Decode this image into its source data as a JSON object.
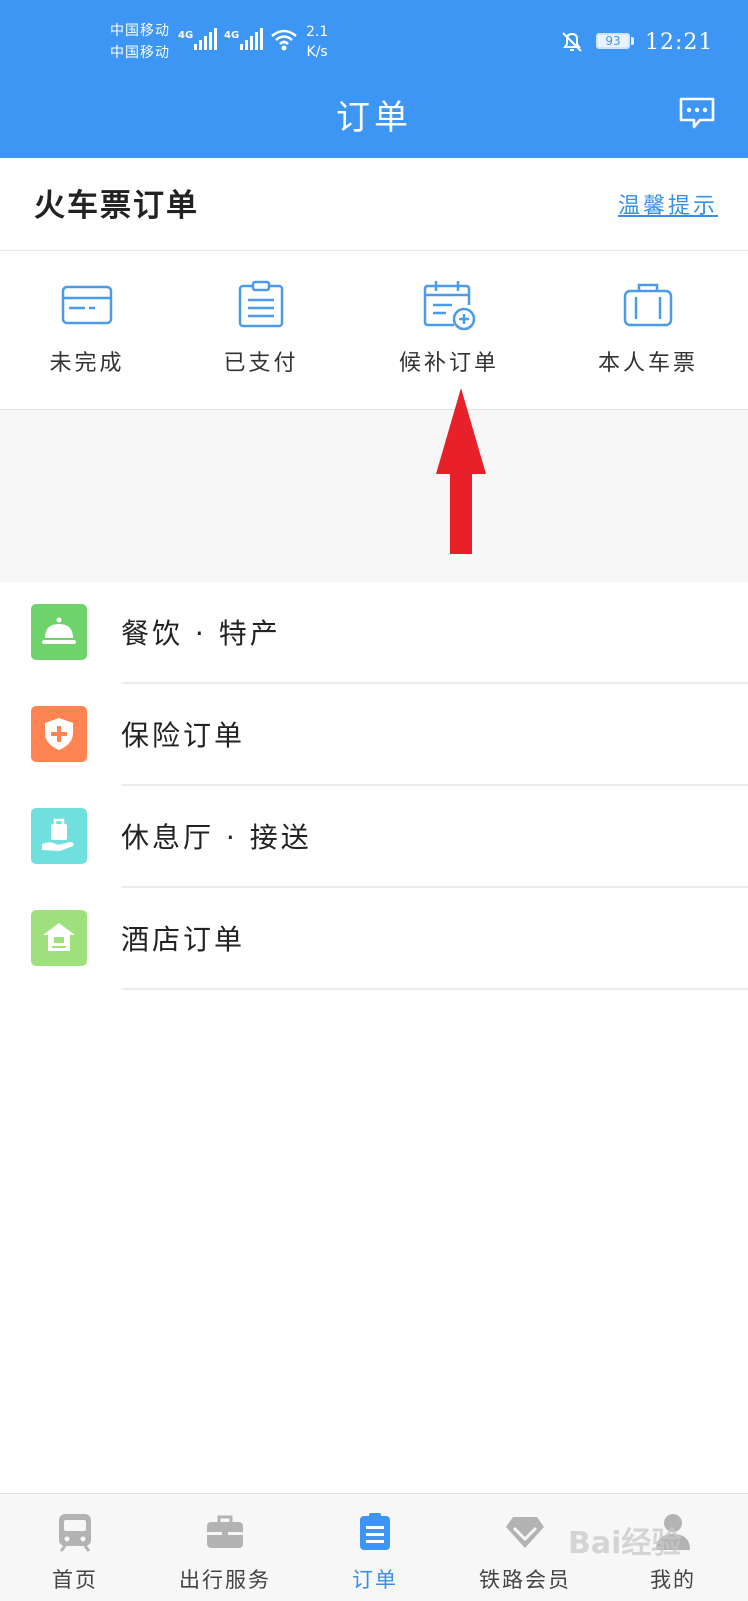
{
  "status_bar": {
    "carrier_1": "中国移动",
    "carrier_2": "中国移动",
    "network_1": "4G",
    "network_2": "4G",
    "speed_value": "2.1",
    "speed_unit": "K/s",
    "battery": "93",
    "time": "12:21"
  },
  "header": {
    "title": "订单",
    "message_icon": "chat-bubble-icon"
  },
  "section": {
    "title": "火车票订单",
    "tip_link": "温馨提示"
  },
  "categories": [
    {
      "label": "未完成",
      "icon": "card-icon"
    },
    {
      "label": "已支付",
      "icon": "clipboard-icon"
    },
    {
      "label": "候补订单",
      "icon": "calendar-plus-icon"
    },
    {
      "label": "本人车票",
      "icon": "suitcase-icon"
    }
  ],
  "list": [
    {
      "label": "餐饮 · 特产",
      "icon": "service-bell-icon",
      "color": "#6fd36c"
    },
    {
      "label": "保险订单",
      "icon": "shield-plus-icon",
      "color": "#ff8451"
    },
    {
      "label": "休息厅 · 接送",
      "icon": "hand-luggage-icon",
      "color": "#6fe0de"
    },
    {
      "label": "酒店订单",
      "icon": "house-icon",
      "color": "#9ee07c"
    }
  ],
  "tabs": [
    {
      "label": "首页",
      "icon": "train-icon"
    },
    {
      "label": "出行服务",
      "icon": "briefcase-icon"
    },
    {
      "label": "订单",
      "icon": "clipboard-list-icon",
      "active": true
    },
    {
      "label": "铁路会员",
      "icon": "diamond-icon"
    },
    {
      "label": "我的",
      "icon": "person-icon"
    }
  ],
  "colors": {
    "primary": "#3d96f4",
    "link": "#3a8fe3",
    "arrow": "#e8202a"
  },
  "watermark": "Bai经验"
}
